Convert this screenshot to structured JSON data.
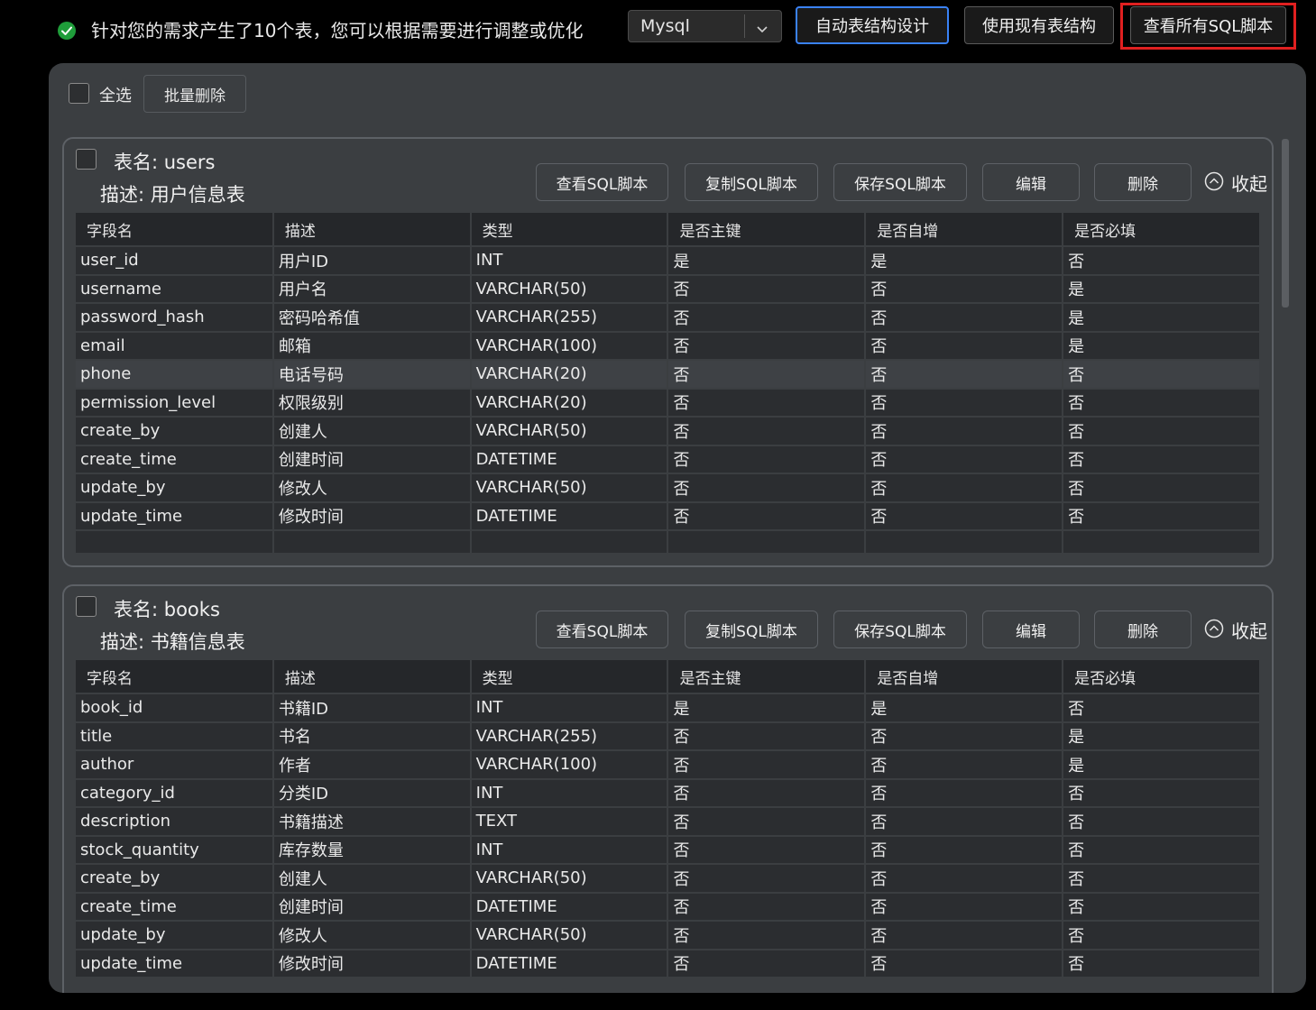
{
  "header": {
    "summary": "针对您的需求产生了10个表，您可以根据需要进行调整或优化",
    "db_select": "Mysql",
    "btn_auto": "自动表结构设计",
    "btn_existing": "使用现有表结构",
    "btn_all_sql": "查看所有SQL脚本"
  },
  "toolbar": {
    "select_all": "全选",
    "bulk_delete": "批量删除"
  },
  "card_actions": {
    "view_sql": "查看SQL脚本",
    "copy_sql": "复制SQL脚本",
    "save_sql": "保存SQL脚本",
    "edit": "编辑",
    "delete": "删除",
    "collapse": "收起"
  },
  "columns": [
    "字段名",
    "描述",
    "类型",
    "是否主键",
    "是否自增",
    "是否必填"
  ],
  "tables": [
    {
      "name_label": "表名: users",
      "desc_label": "描述: 用户信息表",
      "rows": [
        [
          "user_id",
          "用户ID",
          "INT",
          "是",
          "是",
          "否"
        ],
        [
          "username",
          "用户名",
          "VARCHAR(50)",
          "否",
          "否",
          "是"
        ],
        [
          "password_hash",
          "密码哈希值",
          "VARCHAR(255)",
          "否",
          "否",
          "是"
        ],
        [
          "email",
          "邮箱",
          "VARCHAR(100)",
          "否",
          "否",
          "是"
        ],
        [
          "phone",
          "电话号码",
          "VARCHAR(20)",
          "否",
          "否",
          "否"
        ],
        [
          "permission_level",
          "权限级别",
          "VARCHAR(20)",
          "否",
          "否",
          "否"
        ],
        [
          "create_by",
          "创建人",
          "VARCHAR(50)",
          "否",
          "否",
          "否"
        ],
        [
          "create_time",
          "创建时间",
          "DATETIME",
          "否",
          "否",
          "否"
        ],
        [
          "update_by",
          "修改人",
          "VARCHAR(50)",
          "否",
          "否",
          "否"
        ],
        [
          "update_time",
          "修改时间",
          "DATETIME",
          "否",
          "否",
          "否"
        ]
      ]
    },
    {
      "name_label": "表名: books",
      "desc_label": "描述: 书籍信息表",
      "rows": [
        [
          "book_id",
          "书籍ID",
          "INT",
          "是",
          "是",
          "否"
        ],
        [
          "title",
          "书名",
          "VARCHAR(255)",
          "否",
          "否",
          "是"
        ],
        [
          "author",
          "作者",
          "VARCHAR(100)",
          "否",
          "否",
          "是"
        ],
        [
          "category_id",
          "分类ID",
          "INT",
          "否",
          "否",
          "否"
        ],
        [
          "description",
          "书籍描述",
          "TEXT",
          "否",
          "否",
          "否"
        ],
        [
          "stock_quantity",
          "库存数量",
          "INT",
          "否",
          "否",
          "否"
        ],
        [
          "create_by",
          "创建人",
          "VARCHAR(50)",
          "否",
          "否",
          "否"
        ],
        [
          "create_time",
          "创建时间",
          "DATETIME",
          "否",
          "否",
          "否"
        ],
        [
          "update_by",
          "修改人",
          "VARCHAR(50)",
          "否",
          "否",
          "否"
        ],
        [
          "update_time",
          "修改时间",
          "DATETIME",
          "否",
          "否",
          "否"
        ]
      ]
    }
  ],
  "colors": {
    "success": "#1f9d3a",
    "primary_outline": "#3a82f6",
    "highlight_outline": "#e02020"
  }
}
